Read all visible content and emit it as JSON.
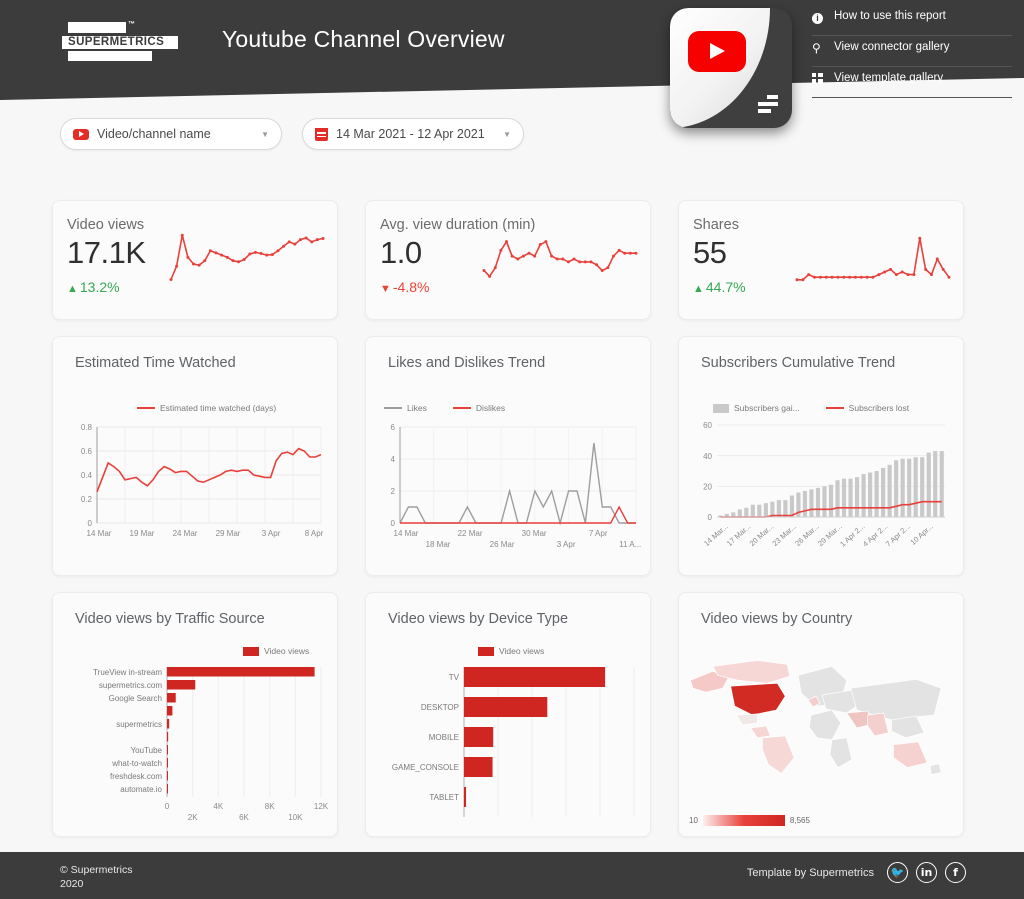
{
  "header": {
    "title": "Youtube Channel Overview",
    "logo_word": "SUPERMETRICS",
    "logo_tm": "™",
    "links": [
      {
        "label": "How to use this report",
        "icon": "info-icon"
      },
      {
        "label": "View connector gallery",
        "icon": "plug-icon"
      },
      {
        "label": "View template gallery",
        "icon": "grid-icon"
      }
    ]
  },
  "filters": {
    "channel": {
      "label": "Video/channel name",
      "icon": "youtube-icon",
      "caret": "▼"
    },
    "date_range": {
      "label": "14 Mar 2021 - 12 Apr 2021",
      "icon": "calendar-icon",
      "caret": "▼"
    }
  },
  "scorecards": [
    {
      "label": "Video views",
      "value": "17.1K",
      "delta": "13.2%",
      "direction": "up",
      "arrow": "▲"
    },
    {
      "label": "Avg. view duration (min)",
      "value": "1.0",
      "delta": "-4.8%",
      "direction": "down",
      "arrow": "▼"
    },
    {
      "label": "Shares",
      "value": "55",
      "delta": "44.7%",
      "direction": "up",
      "arrow": "▲"
    }
  ],
  "cards": {
    "time_watched": "Estimated Time Watched",
    "likes_dislikes": "Likes and Dislikes Trend",
    "subscribers": "Subscribers Cumulative Trend",
    "traffic_source": "Video views by Traffic Source",
    "device_type": "Video views by Device Type",
    "country": "Video views by Country"
  },
  "geo_legend": {
    "min": "10",
    "max": "8,565"
  },
  "footer": {
    "copyright_line1": "© Supermetrics",
    "copyright_line2": "2020",
    "template_by": "Template by Supermetrics",
    "social": [
      {
        "name": "twitter-icon",
        "glyph": "🐦"
      },
      {
        "name": "linkedin-icon",
        "glyph": "in"
      },
      {
        "name": "facebook-icon",
        "glyph": "f"
      }
    ]
  },
  "colors": {
    "brand_red": "#e8403a",
    "dark": "#3c3c3c",
    "green": "#34a853",
    "gray_series": "#a6a6a6"
  },
  "chart_data": [
    {
      "id": "video_views_sparkline",
      "type": "line",
      "title": "Video views",
      "values": [
        300,
        420,
        700,
        500,
        440,
        430,
        470,
        560,
        540,
        520,
        500,
        470,
        460,
        480,
        530,
        545,
        535,
        520,
        525,
        560,
        600,
        640,
        620,
        660,
        675,
        640,
        660,
        670
      ],
      "ylim": [
        250,
        720
      ],
      "color": "#e8403a"
    },
    {
      "id": "avg_view_duration_sparkline",
      "type": "line",
      "title": "Avg. view duration (min)",
      "values": [
        0.95,
        0.93,
        0.96,
        1.02,
        1.05,
        1.0,
        0.99,
        1.0,
        1.01,
        1.0,
        1.04,
        1.05,
        1.0,
        0.99,
        0.99,
        0.98,
        0.99,
        0.98,
        0.98,
        0.98,
        0.97,
        0.95,
        0.96,
        1.0,
        1.02,
        1.01,
        1.01,
        1.01
      ],
      "ylim": [
        0.9,
        1.08
      ],
      "color": "#e8403a"
    },
    {
      "id": "shares_sparkline",
      "type": "line",
      "title": "Shares",
      "values": [
        1,
        1,
        2,
        1.5,
        1.5,
        1.5,
        1.5,
        1.5,
        1.5,
        1.5,
        1.5,
        1.5,
        1.5,
        1.5,
        2,
        2.5,
        3,
        2,
        2.5,
        2,
        2,
        9,
        3,
        2,
        5,
        3,
        1.5
      ],
      "ylim": [
        0,
        10
      ],
      "color": "#e8403a"
    },
    {
      "id": "estimated_time_watched",
      "type": "line",
      "title": "Estimated Time Watched",
      "legend": [
        "Estimated time watched (days)"
      ],
      "ylabel": "",
      "ylim": [
        0,
        0.8
      ],
      "yticks": [
        "0",
        "0.2",
        "0.4",
        "0.6",
        "0.8"
      ],
      "xticks": [
        "14 Mar",
        "19 Mar",
        "24 Mar",
        "29 Mar",
        "3 Apr",
        "8 Apr"
      ],
      "grid": true,
      "series": [
        {
          "name": "Estimated time watched (days)",
          "color": "#e8403a",
          "values": [
            0.26,
            0.38,
            0.5,
            0.47,
            0.43,
            0.36,
            0.37,
            0.38,
            0.34,
            0.31,
            0.36,
            0.43,
            0.47,
            0.45,
            0.42,
            0.43,
            0.43,
            0.39,
            0.35,
            0.34,
            0.36,
            0.38,
            0.4,
            0.43,
            0.44,
            0.43,
            0.44,
            0.44,
            0.4,
            0.39,
            0.38,
            0.38,
            0.52,
            0.58,
            0.59,
            0.57,
            0.62,
            0.6,
            0.55,
            0.55,
            0.57
          ]
        }
      ]
    },
    {
      "id": "likes_dislikes_trend",
      "type": "line",
      "title": "Likes and Dislikes Trend",
      "legend": [
        "Likes",
        "Dislikes"
      ],
      "ylim": [
        0,
        6
      ],
      "yticks": [
        "0",
        "2",
        "4",
        "6"
      ],
      "xticks": [
        "14 Mar",
        "18 Mar",
        "22 Mar",
        "26 Mar",
        "30 Mar",
        "3 Apr",
        "7 Apr",
        "11 A..."
      ],
      "grid": true,
      "series": [
        {
          "name": "Likes",
          "color": "#9e9e9e",
          "values": [
            0,
            1,
            1,
            0,
            0,
            0,
            0,
            0,
            1,
            0,
            0,
            0,
            0,
            2,
            0,
            0,
            2,
            1,
            2,
            0,
            2,
            2,
            0,
            5,
            1,
            1,
            0,
            0,
            0
          ]
        },
        {
          "name": "Dislikes",
          "color": "#e8403a",
          "values": [
            0,
            0,
            0,
            0,
            0,
            0,
            0,
            0,
            0,
            0,
            0,
            0,
            0,
            0,
            0,
            0,
            0,
            0,
            0,
            0,
            0,
            0,
            0,
            0,
            0,
            0,
            1,
            0,
            0
          ]
        }
      ]
    },
    {
      "id": "subscribers_cumulative_trend",
      "type": "bar",
      "title": "Subscribers Cumulative Trend",
      "legend": [
        "Subscribers gai...",
        "Subscribers lost"
      ],
      "ylim": [
        0,
        60
      ],
      "yticks": [
        "0",
        "20",
        "40",
        "60"
      ],
      "xticks": [
        "14 Mar...",
        "17 Mar...",
        "20 Mar...",
        "23 Mar...",
        "26 Mar...",
        "29 Mar...",
        "1 Apr 2...",
        "4 Apr 2...",
        "7 Apr 2...",
        "10 Apr..."
      ],
      "grid": true,
      "series": [
        {
          "name": "Subscribers gained",
          "type": "bar",
          "color": "#c9c9c9",
          "values": [
            1,
            2,
            3,
            5,
            6,
            8,
            8,
            9,
            10,
            11,
            11,
            14,
            16,
            17,
            18,
            19,
            20,
            21,
            24,
            25,
            25,
            26,
            28,
            29,
            30,
            32,
            34,
            37,
            38,
            38,
            39,
            39,
            42,
            43,
            43
          ]
        },
        {
          "name": "Subscribers lost",
          "type": "line",
          "color": "#e8403a",
          "values": [
            0,
            0,
            0,
            0,
            0,
            0,
            0,
            0,
            1,
            1,
            1,
            1,
            3,
            4,
            5,
            5,
            5,
            5,
            6,
            6,
            6,
            6,
            6,
            6,
            6,
            6,
            6,
            7,
            8,
            8,
            9,
            10,
            10,
            10,
            10
          ]
        }
      ]
    },
    {
      "id": "video_views_by_traffic_source",
      "type": "bar",
      "orientation": "horizontal",
      "title": "Video views by Traffic Source",
      "legend": [
        "Video views"
      ],
      "categories": [
        "TrueView in-stream",
        "supermetrics.com",
        "Google Search",
        "",
        "supermetrics",
        "",
        "YouTube",
        "what-to-watch",
        "freshdesk.com",
        "automate.io"
      ],
      "values": [
        11500,
        2200,
        680,
        420,
        170,
        90,
        70,
        40,
        25,
        15
      ],
      "xticks": [
        "0",
        "2K",
        "4K",
        "6K",
        "8K",
        "10K",
        "12K"
      ],
      "xlim": [
        0,
        12000
      ],
      "color": "#cf2621"
    },
    {
      "id": "video_views_by_device_type",
      "type": "bar",
      "orientation": "horizontal",
      "title": "Video views by Device Type",
      "legend": [
        "Video views"
      ],
      "categories": [
        "TV",
        "DESKTOP",
        "MOBILE",
        "GAME_CONSOLE",
        "TABLET"
      ],
      "values": [
        8300,
        4900,
        1720,
        1680,
        120
      ],
      "xticks": [
        "0",
        "2K",
        "4K",
        "6K",
        "8K",
        "10K"
      ],
      "xlim": [
        0,
        10000
      ],
      "color": "#cf2621"
    },
    {
      "id": "video_views_by_country",
      "type": "heatmap",
      "title": "Video views by Country",
      "legend_min": "10",
      "legend_max": "8,565",
      "countries": [
        {
          "name": "United States",
          "value": 8565
        },
        {
          "name": "Canada",
          "value": 900
        },
        {
          "name": "United Kingdom",
          "value": 600
        },
        {
          "name": "Australia",
          "value": 420
        },
        {
          "name": "India",
          "value": 380
        },
        {
          "name": "Brazil",
          "value": 250
        },
        {
          "name": "Mexico",
          "value": 180
        }
      ]
    }
  ]
}
